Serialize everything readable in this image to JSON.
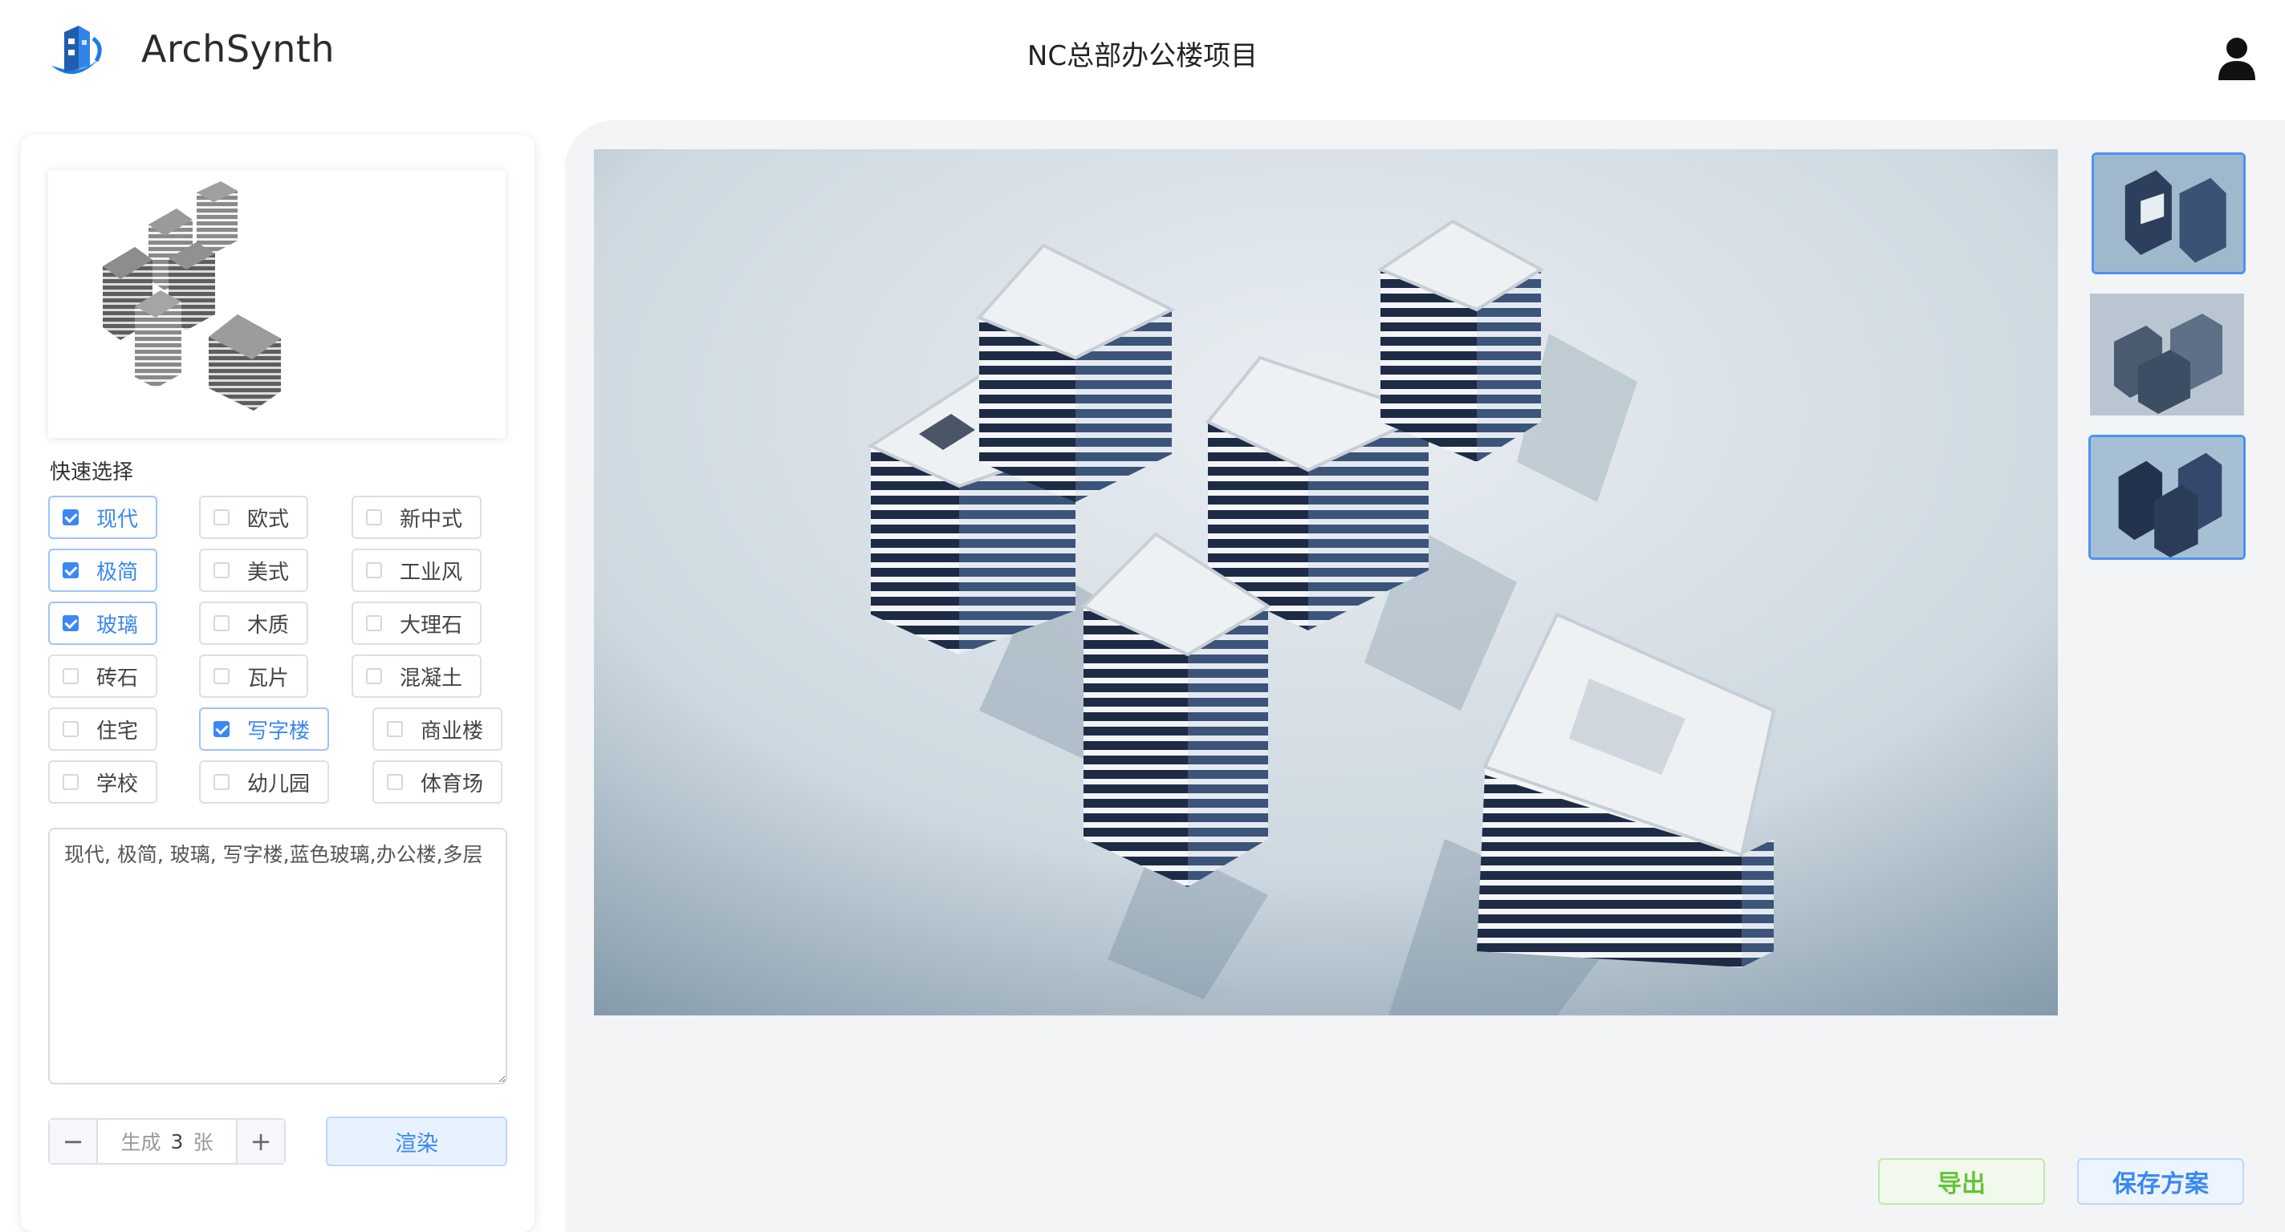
{
  "header": {
    "app_name": "ArchSynth",
    "project_title": "NC总部办公楼项目",
    "logo_icon": "building-logo-icon",
    "user_icon": "user-icon"
  },
  "sidebar": {
    "quick_select_label": "快速选择",
    "tags": [
      {
        "label": "现代",
        "checked": true
      },
      {
        "label": "欧式",
        "checked": false
      },
      {
        "label": "新中式",
        "checked": false
      },
      {
        "label": "极简",
        "checked": true
      },
      {
        "label": "美式",
        "checked": false
      },
      {
        "label": "工业风",
        "checked": false
      },
      {
        "label": "玻璃",
        "checked": true
      },
      {
        "label": "木质",
        "checked": false
      },
      {
        "label": "大理石",
        "checked": false
      },
      {
        "label": "砖石",
        "checked": false
      },
      {
        "label": "瓦片",
        "checked": false
      },
      {
        "label": "混凝土",
        "checked": false
      },
      {
        "label": "住宅",
        "checked": false
      },
      {
        "label": "写字楼",
        "checked": true
      },
      {
        "label": "商业楼",
        "checked": false
      },
      {
        "label": "学校",
        "checked": false
      },
      {
        "label": "幼儿园",
        "checked": false
      },
      {
        "label": "体育场",
        "checked": false
      }
    ],
    "prompt_text": "现代, 极简, 玻璃, 写字楼,蓝色玻璃,办公楼,多层",
    "generate": {
      "prefix": "生成",
      "count": "3",
      "suffix": "张",
      "minus": "−",
      "plus": "+"
    },
    "render_label": "渲染"
  },
  "main": {
    "thumbnails": [
      {
        "selected": true
      },
      {
        "selected": false
      },
      {
        "selected": true
      }
    ],
    "export_label": "导出",
    "save_label": "保存方案"
  },
  "colors": {
    "accent": "#3b87f5",
    "export_green": "#67c23a",
    "panel_bg": "#f3f4f6"
  }
}
